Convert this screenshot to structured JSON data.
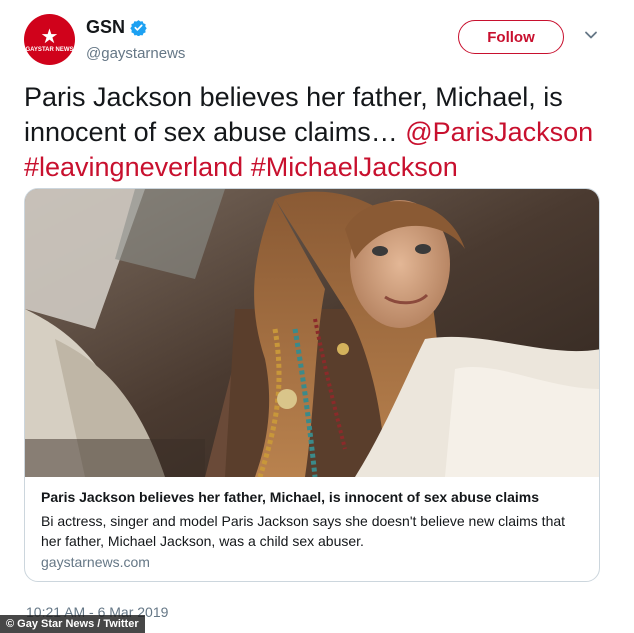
{
  "header": {
    "avatar_text": "GAYSTAR NEWS",
    "display_name": "GSN",
    "handle": "@gaystarnews",
    "follow_label": "Follow"
  },
  "tweet": {
    "text_plain": "Paris Jackson believes her father, Michael, is innocent of sex abuse claims… ",
    "mention": "@ParisJackson",
    "hashtag1": "#leavingneverland",
    "hashtag2": "#MichaelJackson",
    "timestamp": "10:21 AM - 6 Mar 2019"
  },
  "card": {
    "title": "Paris Jackson believes her father, Michael, is innocent of sex abuse claims",
    "description": "Bi actress, singer and model Paris Jackson says she doesn't believe new claims that her father, Michael Jackson, was a child sex abuser.",
    "domain": "gaystarnews.com"
  },
  "credit": "© Gay Star News / Twitter",
  "colors": {
    "brand_red": "#c8102e",
    "avatar_red": "#d0021b",
    "verified_blue": "#1da1f2",
    "meta_gray": "#657786"
  },
  "icons": {
    "verified": "verified-badge-icon",
    "caret": "chevron-down-icon",
    "avatar_star": "star-icon"
  }
}
